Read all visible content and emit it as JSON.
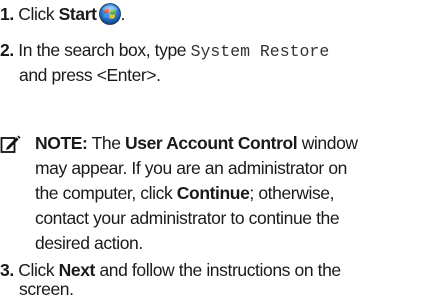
{
  "steps": [
    {
      "number": "1.",
      "text_before": "Click ",
      "bold": "Start",
      "text_after": ".",
      "icon": "windows-start-orb-icon"
    },
    {
      "number": "2.",
      "text_before": "In the search box, type ",
      "mono": "System Restore",
      "line2": "and press <Enter>."
    },
    {
      "number": "3.",
      "text_before": "Click ",
      "bold": "Next",
      "text_after": " and follow the instructions on the",
      "line2": "screen."
    }
  ],
  "note": {
    "icon": "pencil-note-icon",
    "label": "NOTE:",
    "l1_a": " The ",
    "l1_b": "User Account Control",
    "l1_c": " window",
    "l2": "may appear. If you are an administrator on",
    "l3_a": "the computer, click ",
    "l3_b": "Continue",
    "l3_c": "; otherwise,",
    "l4": "contact your administrator to continue the",
    "l5": "desired action."
  },
  "colors": {
    "text": "#1a1a1a",
    "orb_blue": "#2f7fd3",
    "orb_red": "#e8452c",
    "orb_green": "#55b52e",
    "orb_yellow": "#f6c21c"
  }
}
